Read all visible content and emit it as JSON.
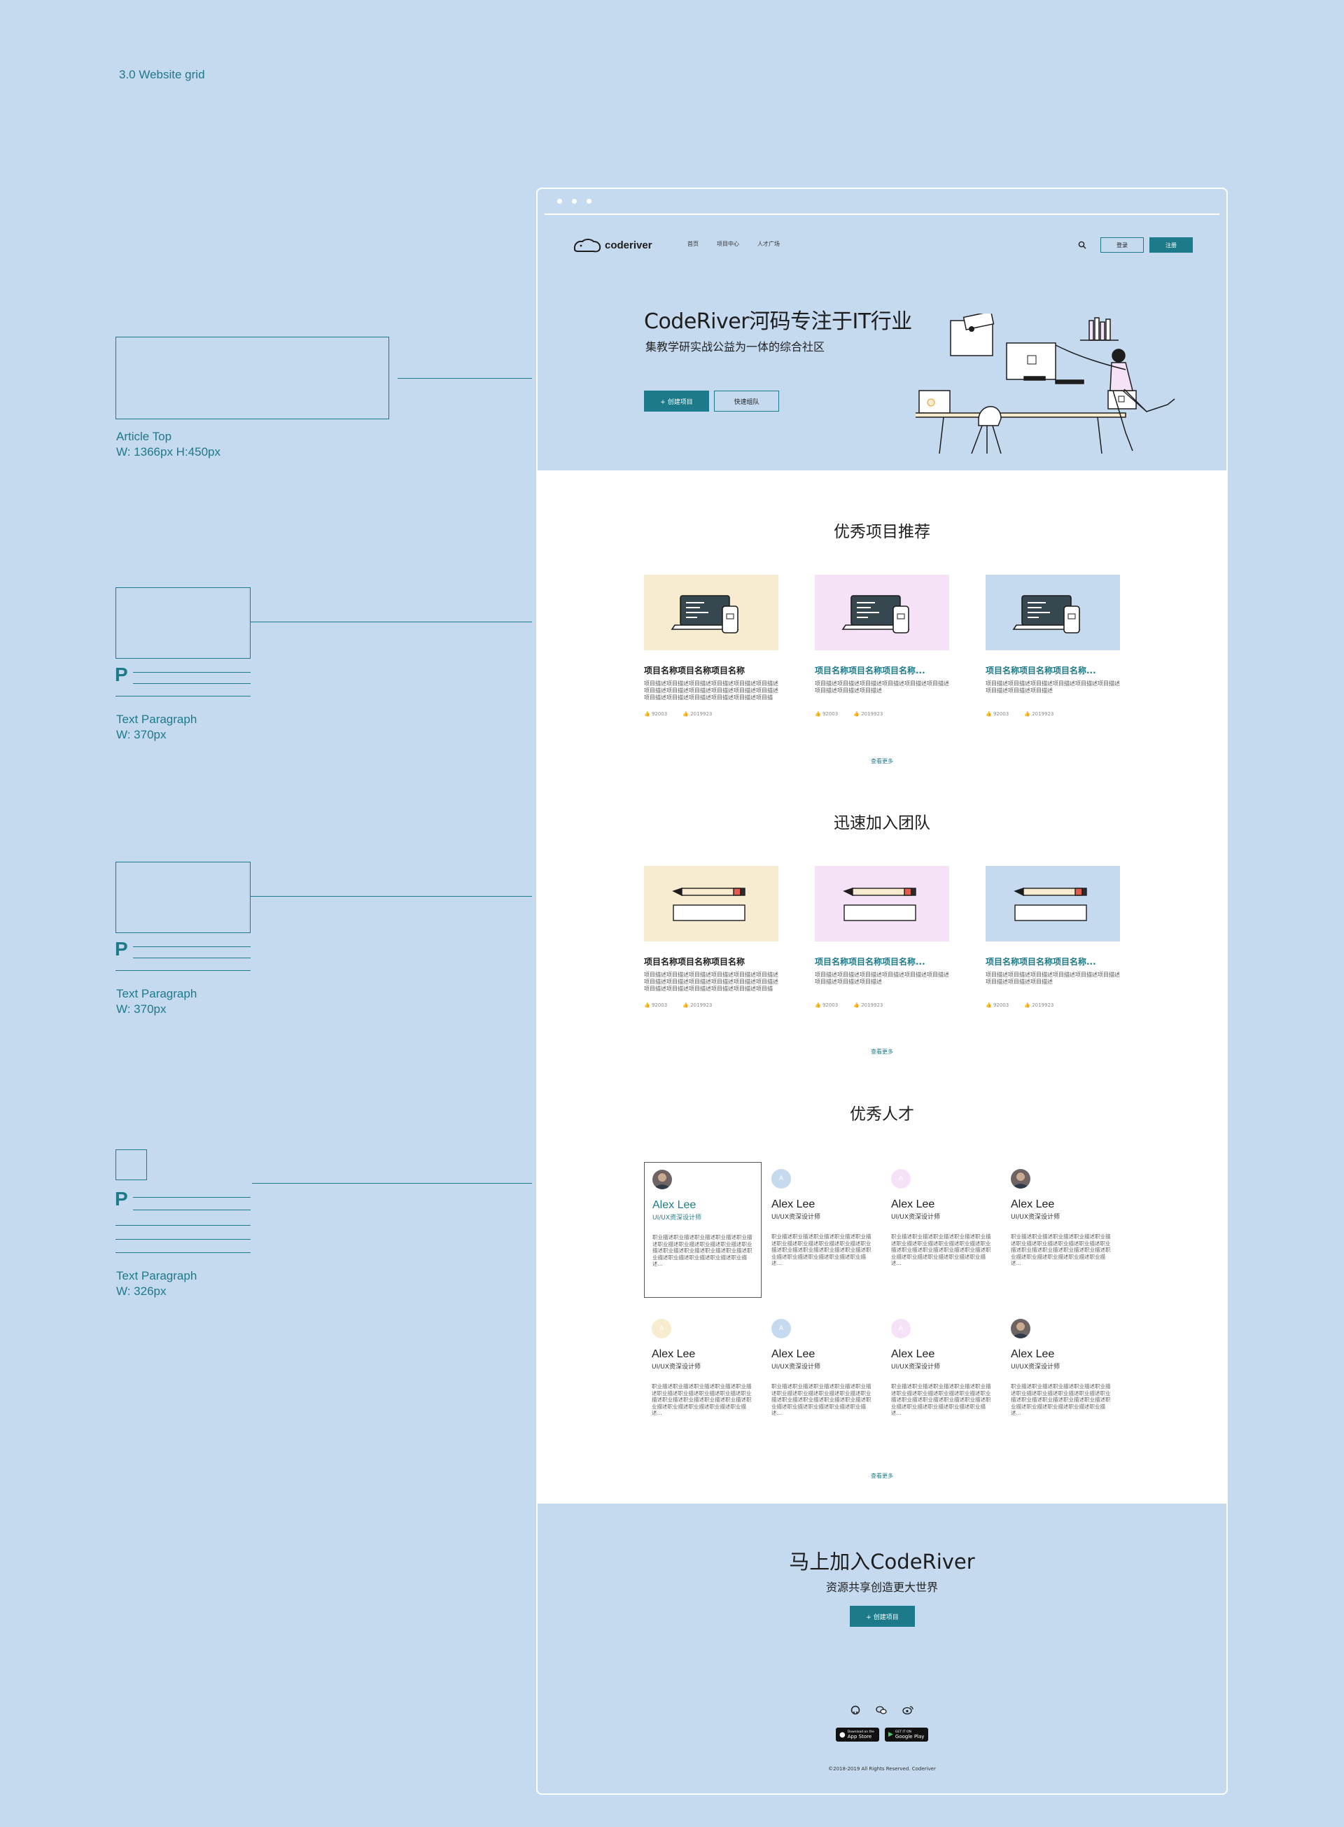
{
  "canvas": {
    "label": "3.0  Website  grid"
  },
  "annotations": [
    {
      "title": "Article Top",
      "size": "W: 1366px H:450px"
    },
    {
      "title": "Text Paragraph",
      "size": "W: 370px",
      "mark": "P"
    },
    {
      "title": "Text Paragraph",
      "size": "W: 370px",
      "mark": "P"
    },
    {
      "title": "Text Paragraph",
      "size": "W: 326px",
      "mark": "P"
    }
  ],
  "nav": {
    "brand": "coderiver",
    "links": [
      "首页",
      "项目中心",
      "人才广场"
    ],
    "login": "登录",
    "signup": "注册"
  },
  "hero": {
    "title": "CodeRiver河码专注于IT行业",
    "subtitle": "集教学研实战公益为一体的综合社区",
    "create_button": "+ 创建项目",
    "team_button": "快速组队"
  },
  "projects": {
    "title": "优秀项目推荐",
    "more": "查看更多",
    "cards": [
      {
        "title": "项目名称项目名称项目名称",
        "desc": "项目描述项目描述项目描述项目描述项目描述项目描述项目描述项目描述项目描述项目描述项目描述项目描述项目描述项目描述项目描述项目描述项目描述项目描述...",
        "likes": "92003",
        "date": "2019923",
        "bg": "#f8ecd0"
      },
      {
        "title": "项目名称项目名称项目名称...",
        "desc": "项目描述项目描述项目描述项目描述项目描述项目描述项目描述项目描述项目描述",
        "likes": "92003",
        "date": "2019923",
        "bg": "#f6e2f7"
      },
      {
        "title": "项目名称项目名称项目名称...",
        "desc": "项目描述项目描述项目描述项目描述项目描述项目描述项目描述项目描述项目描述",
        "likes": "92003",
        "date": "2019923",
        "bg": "#c5d9ef"
      }
    ]
  },
  "teams": {
    "title": "迅速加入团队",
    "more": "查看更多",
    "cards": [
      {
        "title": "项目名称项目名称项目名称",
        "desc": "项目描述项目描述项目描述项目描述项目描述项目描述项目描述项目描述项目描述项目描述项目描述项目描述项目描述项目描述项目描述项目描述项目描述项目描述...",
        "likes": "92003",
        "date": "2019923",
        "bg": "#f8ecd0"
      },
      {
        "title": "项目名称项目名称项目名称...",
        "desc": "项目描述项目描述项目描述项目描述项目描述项目描述项目描述项目描述项目描述",
        "likes": "92003",
        "date": "2019923",
        "bg": "#f6e2f7"
      },
      {
        "title": "项目名称项目名称项目名称...",
        "desc": "项目描述项目描述项目描述项目描述项目描述项目描述项目描述项目描述项目描述",
        "likes": "92003",
        "date": "2019923",
        "bg": "#c5d9ef"
      }
    ]
  },
  "talents": {
    "title": "优秀人才",
    "more": "查看更多",
    "people": [
      {
        "name": "Alex Lee",
        "role": "UI/UX资深设计师",
        "desc": "职业描述职业描述职业描述职业描述职业描述职业描述职业描述职业描述职业描述职业描述职业描述职业描述职业描述职业描述职业描述职业描述职业描述职业描述职业描述...",
        "avatar": "photo",
        "color": "#7a6a6a"
      },
      {
        "name": "Alex Lee",
        "role": "UI/UX资深设计师",
        "desc": "职业描述职业描述职业描述职业描述职业描述职业描述职业描述职业描述职业描述职业描述职业描述职业描述职业描述职业描述职业描述职业描述职业描述职业描述职业描述...",
        "avatar": "A",
        "color": "#c5d9ef"
      },
      {
        "name": "Alex Lee",
        "role": "UI/UX资深设计师",
        "desc": "职业描述职业描述职业描述职业描述职业描述职业描述职业描述职业描述职业描述职业描述职业描述职业描述职业描述职业描述职业描述职业描述职业描述职业描述职业描述...",
        "avatar": "A",
        "color": "#f6e2f7"
      },
      {
        "name": "Alex Lee",
        "role": "UI/UX资深设计师",
        "desc": "职业描述职业描述职业描述职业描述职业描述职业描述职业描述职业描述职业描述职业描述职业描述职业描述职业描述职业描述职业描述职业描述职业描述职业描述职业描述...",
        "avatar": "photo",
        "color": "#7a6a6a"
      },
      {
        "name": "Alex Lee",
        "role": "UI/UX资深设计师",
        "desc": "职业描述职业描述职业描述职业描述职业描述职业描述职业描述职业描述职业描述职业描述职业描述职业描述职业描述职业描述职业描述职业描述职业描述职业描述职业描述...",
        "avatar": "A",
        "color": "#f8ecd0"
      },
      {
        "name": "Alex Lee",
        "role": "UI/UX资深设计师",
        "desc": "职业描述职业描述职业描述职业描述职业描述职业描述职业描述职业描述职业描述职业描述职业描述职业描述职业描述职业描述职业描述职业描述职业描述职业描述职业描述...",
        "avatar": "A",
        "color": "#c5d9ef"
      },
      {
        "name": "Alex Lee",
        "role": "UI/UX资深设计师",
        "desc": "职业描述职业描述职业描述职业描述职业描述职业描述职业描述职业描述职业描述职业描述职业描述职业描述职业描述职业描述职业描述职业描述职业描述职业描述职业描述...",
        "avatar": "A",
        "color": "#f6e2f7"
      },
      {
        "name": "Alex Lee",
        "role": "UI/UX资深设计师",
        "desc": "职业描述职业描述职业描述职业描述职业描述职业描述职业描述职业描述职业描述职业描述职业描述职业描述职业描述职业描述职业描述职业描述职业描述职业描述职业描述...",
        "avatar": "photo",
        "color": "#7a6a6a"
      }
    ]
  },
  "cta": {
    "title": "马上加入CodeRiver",
    "subtitle": "资源共享创造更大世界",
    "button": "+ 创建项目"
  },
  "footer": {
    "socials": [
      "github-icon",
      "wechat-icon",
      "weibo-icon"
    ],
    "app_store": {
      "small": "Download on the",
      "big": "App Store"
    },
    "google_play": {
      "small": "GET IT ON",
      "big": "Google Play"
    },
    "copyright": "©2018-2019 All Rights Reserved. Coderiver"
  },
  "colors": {
    "accent": "#1d7a8a",
    "canvas": "#c5d9ef",
    "yellow": "#f8ecd0",
    "pink": "#f6e2f7"
  }
}
